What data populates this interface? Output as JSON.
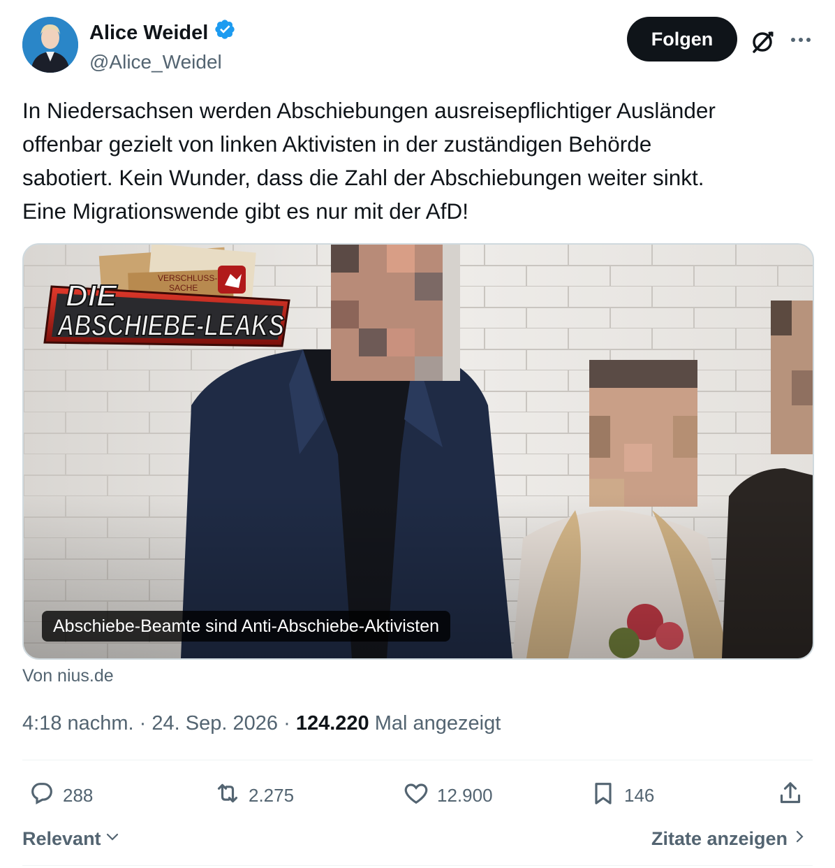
{
  "author": {
    "display_name": "Alice Weidel",
    "handle": "@Alice_Weidel",
    "verified": true,
    "avatar": "profile-photo"
  },
  "header": {
    "follow_label": "Folgen",
    "grok_icon": "grok-icon",
    "more_icon": "more-icon"
  },
  "tweet": {
    "text": "In Niedersachsen werden Abschiebungen ausreisepflichtiger Ausländer\noffenbar gezielt von linken Aktivisten in der zuständigen Behörde\nsabotiert. Kein Wunder, dass die Zahl der Abschiebungen weiter sinkt.\nEine Migrationswende gibt es nur mit der AfD!"
  },
  "media": {
    "logo_line1": "DIE",
    "logo_line2": "ABSCHIEBE-LEAKS",
    "stamp_text_1": "VERSCHLUSS-",
    "stamp_text_2": "SACHE",
    "caption": "Abschiebe-Beamte sind Anti-Abschiebe-Aktivisten",
    "source": "Von nius.de"
  },
  "meta": {
    "time": "4:18 nachm.",
    "date": "24. Sep. 2026",
    "separator": "·",
    "views": "124.220",
    "views_label": "Mal angezeigt"
  },
  "actions": {
    "replies": "288",
    "reposts": "2.275",
    "likes": "12.900",
    "bookmarks": "146"
  },
  "footer": {
    "sort_label": "Relevant",
    "quotes_label": "Zitate anzeigen"
  },
  "colors": {
    "verified_blue": "#1d9bf0",
    "text_primary": "#0f1419",
    "text_secondary": "#536471",
    "divider": "#eff3f4"
  }
}
